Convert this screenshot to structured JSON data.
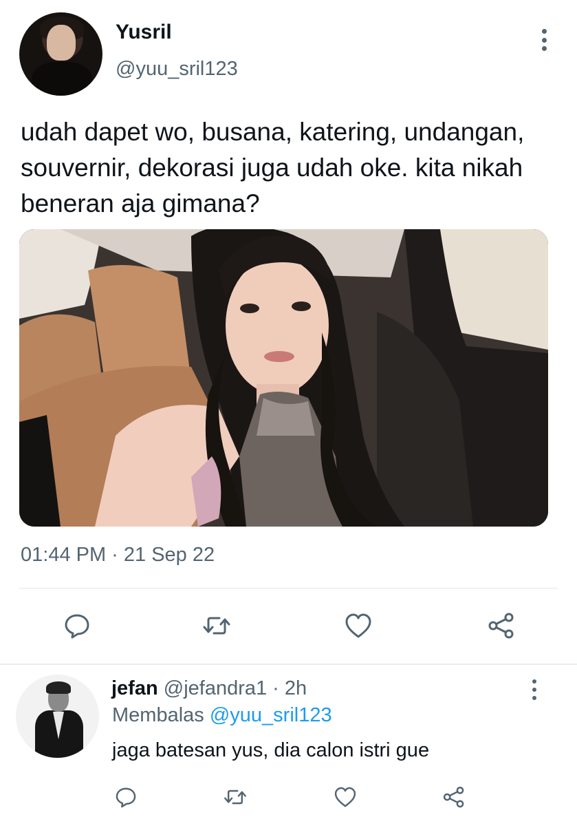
{
  "main_tweet": {
    "display_name": "Yusril",
    "handle": "@yuu_sril123",
    "text": "udah dapet wo, busana, katering, undangan, souvernir, dekorasi juga udah oke. kita nikah beneran aja gimana?",
    "timestamp": "01:44 PM · 21 Sep 22",
    "actions": [
      {
        "icon": "reply-icon"
      },
      {
        "icon": "retweet-icon"
      },
      {
        "icon": "like-icon"
      },
      {
        "icon": "share-icon"
      }
    ]
  },
  "reply": {
    "display_name": "jefan",
    "meta": "@jefandra1 · 2h",
    "replying_label": "Membalas",
    "replying_to": "@yuu_sril123",
    "text": "jaga batesan yus, dia calon istri gue",
    "actions": [
      {
        "icon": "reply-icon"
      },
      {
        "icon": "retweet-icon"
      },
      {
        "icon": "like-icon"
      },
      {
        "icon": "share-icon"
      }
    ]
  },
  "colors": {
    "text_primary": "#0f1419",
    "text_secondary": "#536471",
    "accent": "#1d9bf0",
    "divider": "#e1e8ed"
  }
}
